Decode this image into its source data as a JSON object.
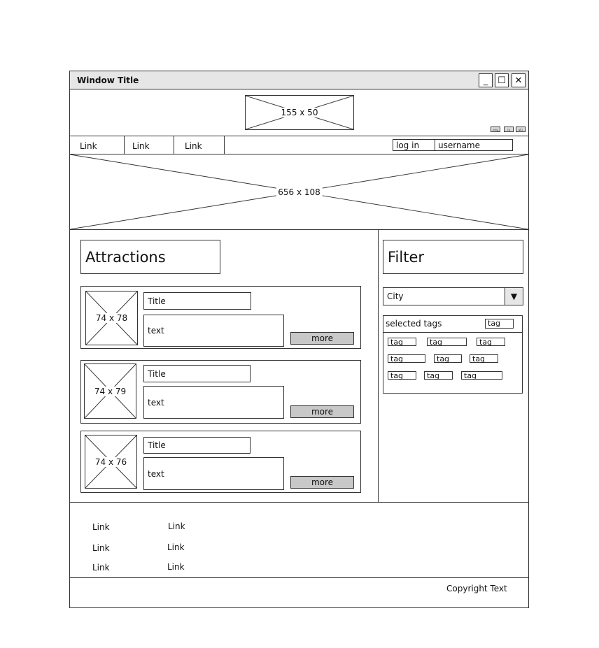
{
  "window": {
    "title": "Window Title",
    "min_glyph": "_",
    "max_glyph": "☐",
    "close_glyph": "✕"
  },
  "header": {
    "logo_label": "155 x 50",
    "languages": [
      "eng",
      "ru",
      "ukr"
    ]
  },
  "nav": {
    "links": [
      "Link",
      "Link",
      "Link"
    ],
    "login_label": "log in",
    "username_value": "username"
  },
  "banner": {
    "label": "656 x 108"
  },
  "main": {
    "heading": "Attractions",
    "items": [
      {
        "image_label": "74 x 78",
        "title": "Title",
        "text": "text",
        "more_label": "more"
      },
      {
        "image_label": "74 x 79",
        "title": "Title",
        "text": "text",
        "more_label": "more"
      },
      {
        "image_label": "74 x 76",
        "title": "Title",
        "text": "text",
        "more_label": "more"
      }
    ]
  },
  "filter": {
    "heading": "Filter",
    "city_value": "City",
    "dropdown_glyph": "▼",
    "selected_tags_label": "selected tags",
    "selected_tag": "tag",
    "tags": [
      "tag",
      "tag",
      "tag",
      "tag",
      "tag",
      "tag",
      "tag",
      "tag",
      "tag"
    ]
  },
  "footer": {
    "links": [
      "Link",
      "Link",
      "Link",
      "Link",
      "Link",
      "Link"
    ],
    "copyright": "Copyright Text"
  }
}
